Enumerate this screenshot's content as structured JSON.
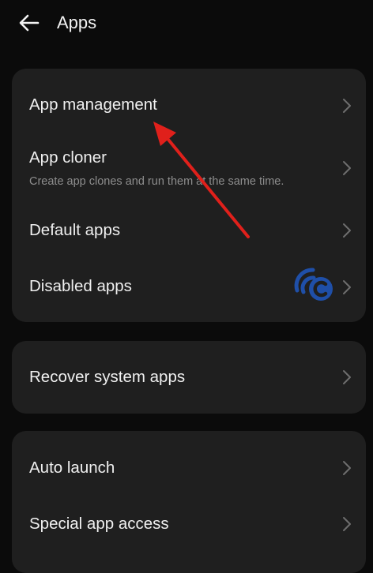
{
  "header": {
    "title": "Apps",
    "back_icon": "back-arrow-icon"
  },
  "groups": [
    {
      "items": [
        {
          "label": "App management",
          "subtitle": ""
        },
        {
          "label": "App cloner",
          "subtitle": "Create app clones and run them at the same time."
        },
        {
          "label": "Default apps",
          "subtitle": ""
        },
        {
          "label": "Disabled apps",
          "subtitle": ""
        }
      ]
    },
    {
      "items": [
        {
          "label": "Recover system apps",
          "subtitle": ""
        }
      ]
    },
    {
      "items": [
        {
          "label": "Auto launch",
          "subtitle": ""
        },
        {
          "label": "Special app access",
          "subtitle": ""
        }
      ]
    }
  ],
  "overlay": {
    "annotation": "red-arrow-pointing-to-app-management",
    "arrow_color": "#e0201b",
    "watermark": "blue-c-logo-watermark",
    "watermark_color": "#1f4fa8"
  },
  "colors": {
    "background": "#0b0b0b",
    "card": "#1f1f1f",
    "text_primary": "#efefef",
    "text_secondary": "#8d8d8d",
    "chevron": "#6e6e6e"
  }
}
